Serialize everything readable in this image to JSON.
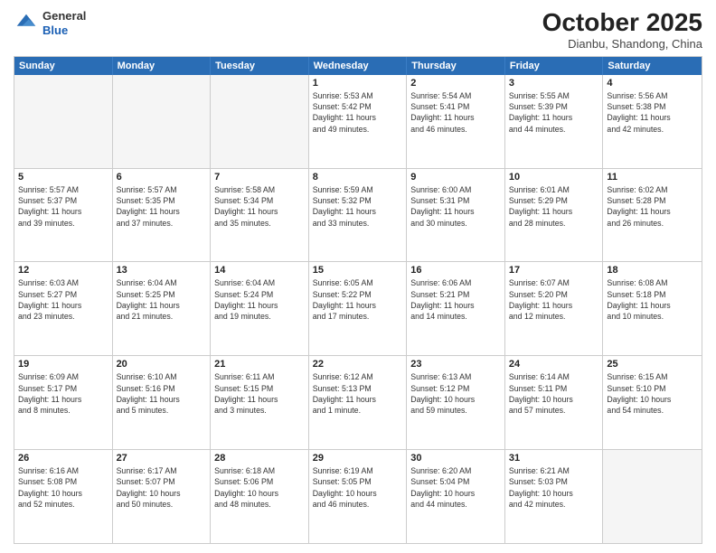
{
  "logo": {
    "general": "General",
    "blue": "Blue"
  },
  "title": "October 2025",
  "subtitle": "Dianbu, Shandong, China",
  "days_of_week": [
    "Sunday",
    "Monday",
    "Tuesday",
    "Wednesday",
    "Thursday",
    "Friday",
    "Saturday"
  ],
  "weeks": [
    [
      {
        "day": "",
        "info": ""
      },
      {
        "day": "",
        "info": ""
      },
      {
        "day": "",
        "info": ""
      },
      {
        "day": "1",
        "info": "Sunrise: 5:53 AM\nSunset: 5:42 PM\nDaylight: 11 hours\nand 49 minutes."
      },
      {
        "day": "2",
        "info": "Sunrise: 5:54 AM\nSunset: 5:41 PM\nDaylight: 11 hours\nand 46 minutes."
      },
      {
        "day": "3",
        "info": "Sunrise: 5:55 AM\nSunset: 5:39 PM\nDaylight: 11 hours\nand 44 minutes."
      },
      {
        "day": "4",
        "info": "Sunrise: 5:56 AM\nSunset: 5:38 PM\nDaylight: 11 hours\nand 42 minutes."
      }
    ],
    [
      {
        "day": "5",
        "info": "Sunrise: 5:57 AM\nSunset: 5:37 PM\nDaylight: 11 hours\nand 39 minutes."
      },
      {
        "day": "6",
        "info": "Sunrise: 5:57 AM\nSunset: 5:35 PM\nDaylight: 11 hours\nand 37 minutes."
      },
      {
        "day": "7",
        "info": "Sunrise: 5:58 AM\nSunset: 5:34 PM\nDaylight: 11 hours\nand 35 minutes."
      },
      {
        "day": "8",
        "info": "Sunrise: 5:59 AM\nSunset: 5:32 PM\nDaylight: 11 hours\nand 33 minutes."
      },
      {
        "day": "9",
        "info": "Sunrise: 6:00 AM\nSunset: 5:31 PM\nDaylight: 11 hours\nand 30 minutes."
      },
      {
        "day": "10",
        "info": "Sunrise: 6:01 AM\nSunset: 5:29 PM\nDaylight: 11 hours\nand 28 minutes."
      },
      {
        "day": "11",
        "info": "Sunrise: 6:02 AM\nSunset: 5:28 PM\nDaylight: 11 hours\nand 26 minutes."
      }
    ],
    [
      {
        "day": "12",
        "info": "Sunrise: 6:03 AM\nSunset: 5:27 PM\nDaylight: 11 hours\nand 23 minutes."
      },
      {
        "day": "13",
        "info": "Sunrise: 6:04 AM\nSunset: 5:25 PM\nDaylight: 11 hours\nand 21 minutes."
      },
      {
        "day": "14",
        "info": "Sunrise: 6:04 AM\nSunset: 5:24 PM\nDaylight: 11 hours\nand 19 minutes."
      },
      {
        "day": "15",
        "info": "Sunrise: 6:05 AM\nSunset: 5:22 PM\nDaylight: 11 hours\nand 17 minutes."
      },
      {
        "day": "16",
        "info": "Sunrise: 6:06 AM\nSunset: 5:21 PM\nDaylight: 11 hours\nand 14 minutes."
      },
      {
        "day": "17",
        "info": "Sunrise: 6:07 AM\nSunset: 5:20 PM\nDaylight: 11 hours\nand 12 minutes."
      },
      {
        "day": "18",
        "info": "Sunrise: 6:08 AM\nSunset: 5:18 PM\nDaylight: 11 hours\nand 10 minutes."
      }
    ],
    [
      {
        "day": "19",
        "info": "Sunrise: 6:09 AM\nSunset: 5:17 PM\nDaylight: 11 hours\nand 8 minutes."
      },
      {
        "day": "20",
        "info": "Sunrise: 6:10 AM\nSunset: 5:16 PM\nDaylight: 11 hours\nand 5 minutes."
      },
      {
        "day": "21",
        "info": "Sunrise: 6:11 AM\nSunset: 5:15 PM\nDaylight: 11 hours\nand 3 minutes."
      },
      {
        "day": "22",
        "info": "Sunrise: 6:12 AM\nSunset: 5:13 PM\nDaylight: 11 hours\nand 1 minute."
      },
      {
        "day": "23",
        "info": "Sunrise: 6:13 AM\nSunset: 5:12 PM\nDaylight: 10 hours\nand 59 minutes."
      },
      {
        "day": "24",
        "info": "Sunrise: 6:14 AM\nSunset: 5:11 PM\nDaylight: 10 hours\nand 57 minutes."
      },
      {
        "day": "25",
        "info": "Sunrise: 6:15 AM\nSunset: 5:10 PM\nDaylight: 10 hours\nand 54 minutes."
      }
    ],
    [
      {
        "day": "26",
        "info": "Sunrise: 6:16 AM\nSunset: 5:08 PM\nDaylight: 10 hours\nand 52 minutes."
      },
      {
        "day": "27",
        "info": "Sunrise: 6:17 AM\nSunset: 5:07 PM\nDaylight: 10 hours\nand 50 minutes."
      },
      {
        "day": "28",
        "info": "Sunrise: 6:18 AM\nSunset: 5:06 PM\nDaylight: 10 hours\nand 48 minutes."
      },
      {
        "day": "29",
        "info": "Sunrise: 6:19 AM\nSunset: 5:05 PM\nDaylight: 10 hours\nand 46 minutes."
      },
      {
        "day": "30",
        "info": "Sunrise: 6:20 AM\nSunset: 5:04 PM\nDaylight: 10 hours\nand 44 minutes."
      },
      {
        "day": "31",
        "info": "Sunrise: 6:21 AM\nSunset: 5:03 PM\nDaylight: 10 hours\nand 42 minutes."
      },
      {
        "day": "",
        "info": ""
      }
    ]
  ]
}
